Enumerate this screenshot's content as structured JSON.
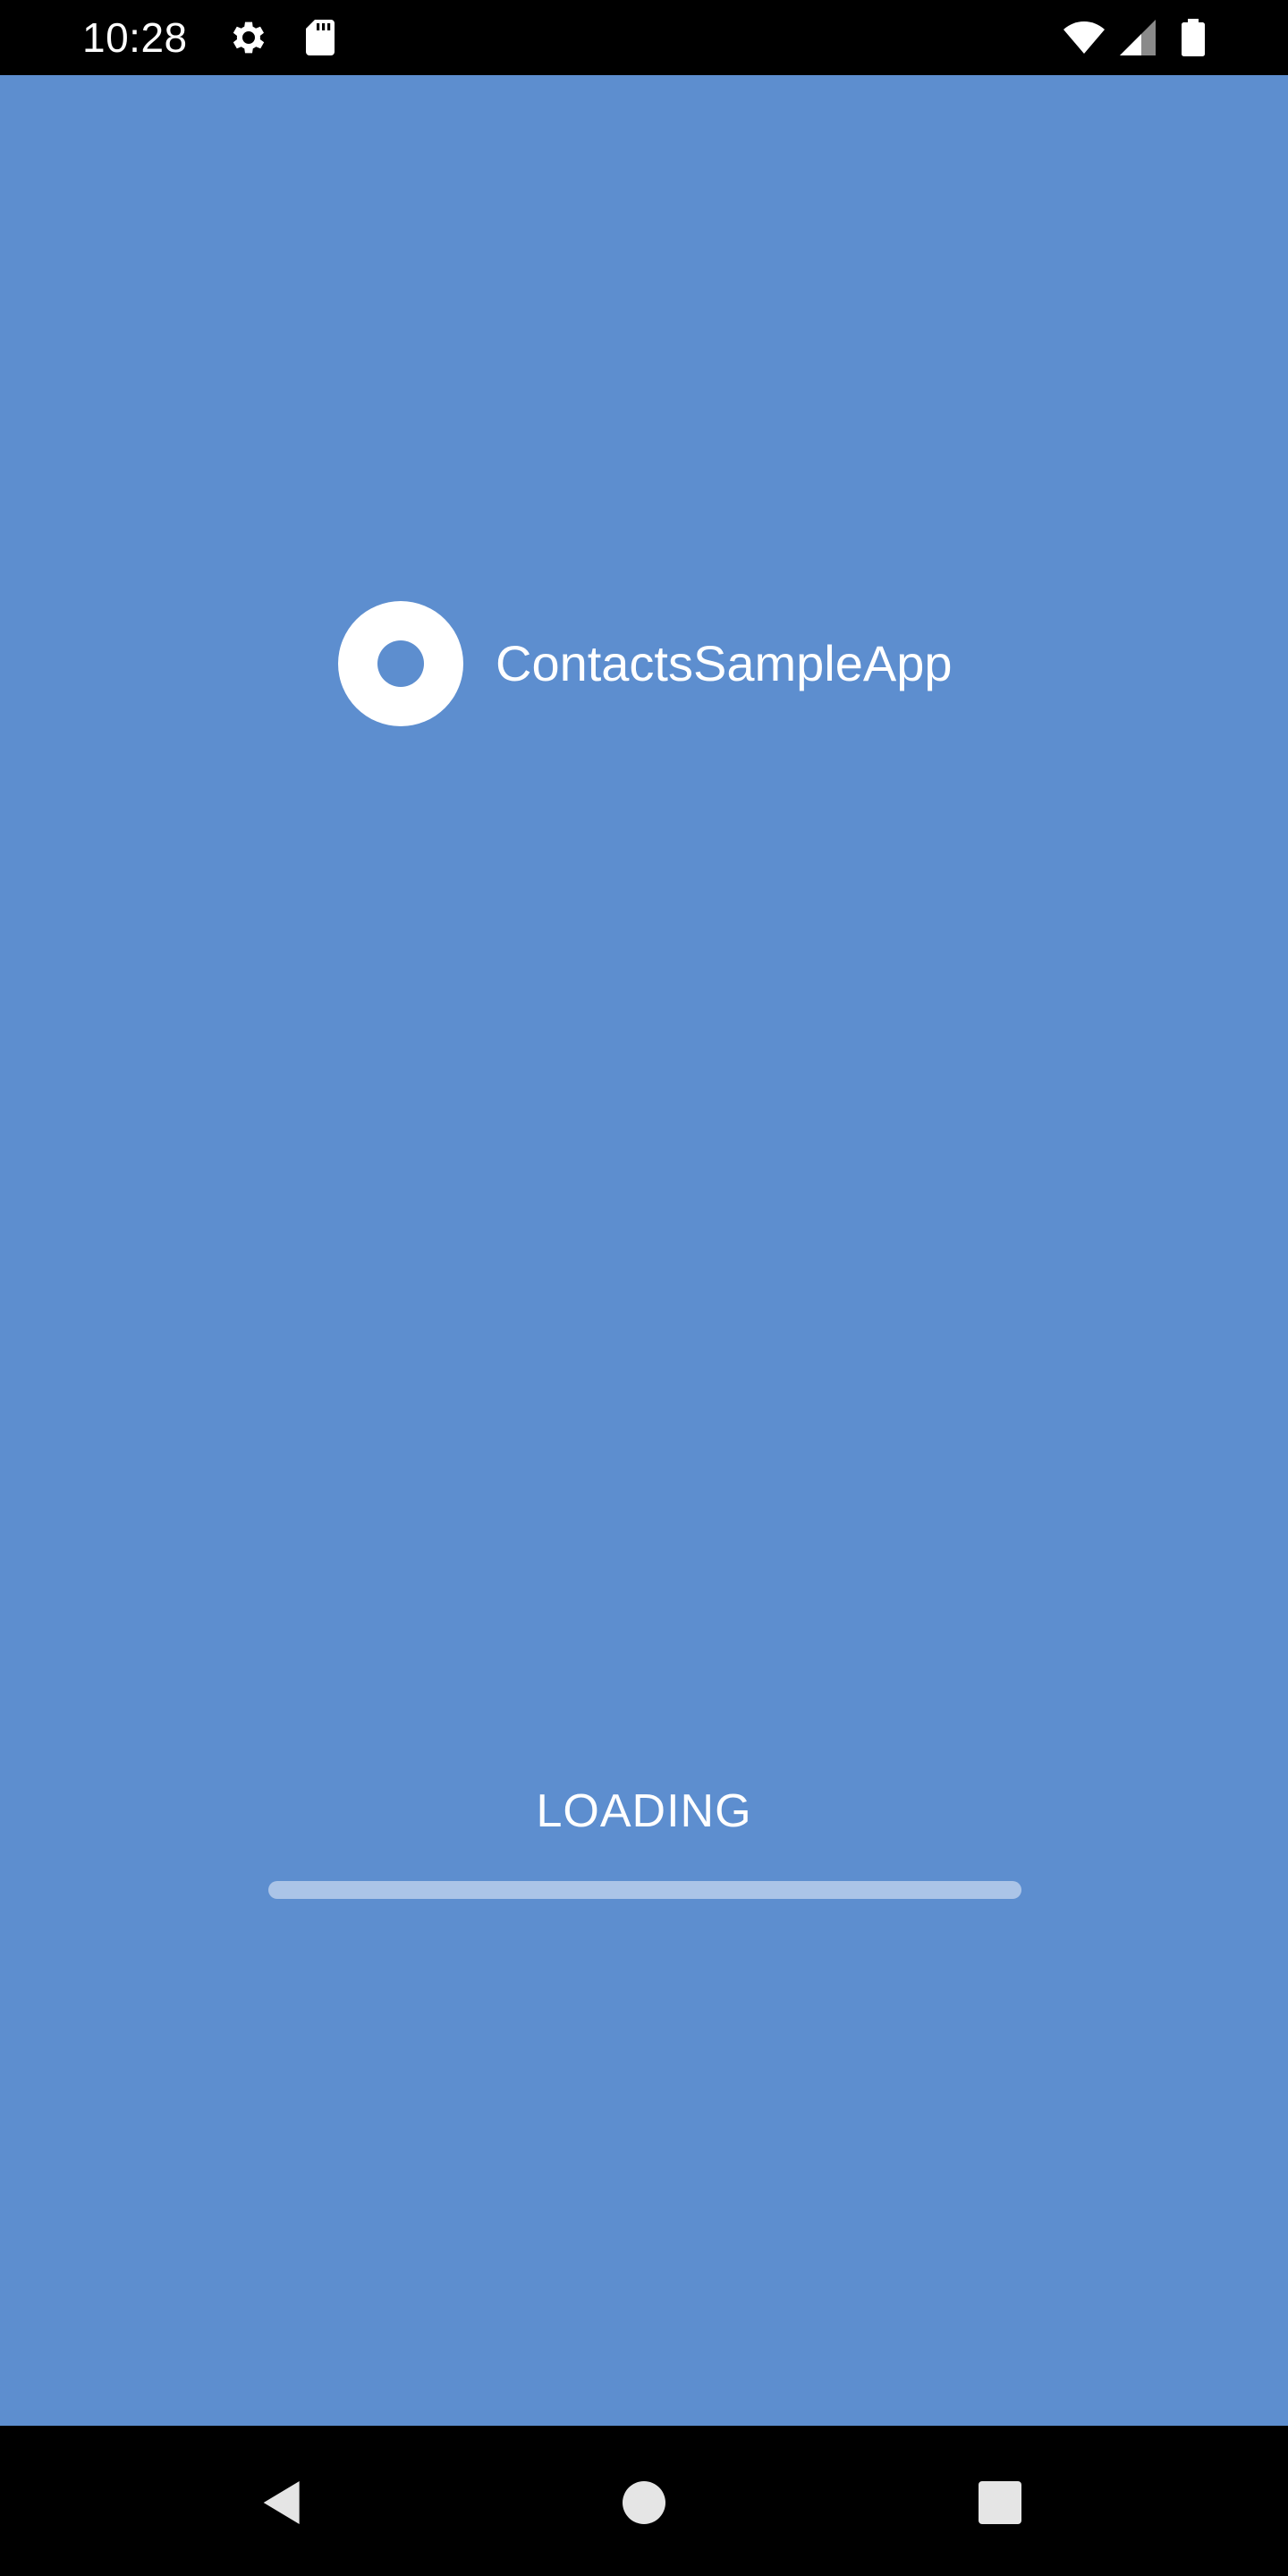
{
  "status_bar": {
    "time": "10:28",
    "icons": [
      "gear-icon",
      "sd-card-icon",
      "wifi-icon",
      "cell-signal-icon",
      "battery-icon"
    ]
  },
  "splash": {
    "background_color": "#5d8ecf",
    "app_name": "ContactsSampleApp",
    "loading_label": "LOADING",
    "progress": 0
  },
  "nav_bar": {
    "buttons": [
      "back-icon",
      "home-icon",
      "recents-icon"
    ]
  }
}
